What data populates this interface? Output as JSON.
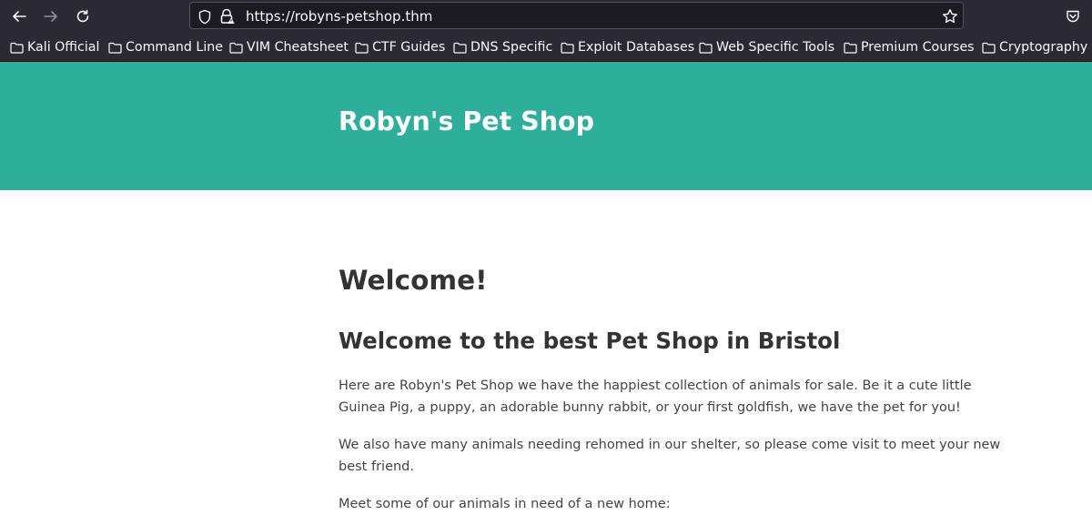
{
  "browser": {
    "url": "https://robyns-petshop.thm",
    "bookmarks": [
      "Kali Official",
      "Command Line",
      "VIM Cheatsheet",
      "CTF Guides",
      "DNS Specific",
      "Exploit Databases",
      "Web Specific Tools",
      "Premium Courses",
      "Cryptography"
    ],
    "icons": {
      "back": "arrow-left-icon",
      "forward": "arrow-right-icon",
      "reload": "reload-icon",
      "tracking": "shield-icon",
      "security": "lock-warning-icon",
      "bookmark_star": "star-icon",
      "pocket": "pocket-icon",
      "folder": "folder-icon"
    },
    "colors": {
      "chrome_bg": "#2b2a33",
      "urlbar_bg": "#1c1b22",
      "text": "#fbfbfe"
    }
  },
  "page": {
    "site_title": "Robyn's Pet Shop",
    "heading": "Welcome!",
    "subheading": "Welcome to the best Pet Shop in Bristol",
    "paragraphs": [
      "Here are Robyn's Pet Shop we have the happiest collection of animals for sale. Be it a cute little Guinea Pig, a puppy, an adorable bunny rabbit, or your first goldfish, we have the pet for you!",
      "We also have many animals needing rehomed in our shelter, so please come visit to meet your new best friend.",
      "Meet some of our animals in need of a new home:"
    ],
    "colors": {
      "header_bg": "#2eaf9b",
      "header_text": "#ffffff",
      "body_text": "#333333"
    }
  }
}
